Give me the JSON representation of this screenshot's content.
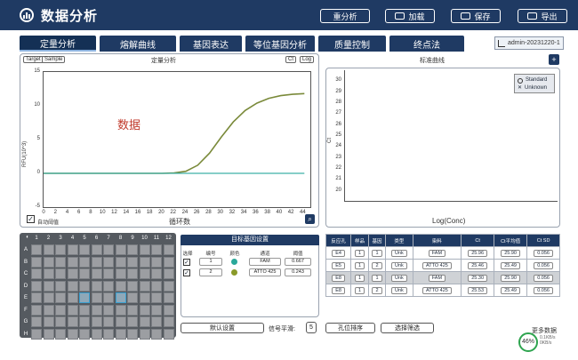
{
  "header": {
    "title": "数据分析",
    "buttons": [
      {
        "label": "重分析",
        "icon": "none"
      },
      {
        "label": "加载",
        "icon": "folder-icon"
      },
      {
        "label": "保存",
        "icon": "save-icon"
      },
      {
        "label": "导出",
        "icon": "export-icon"
      }
    ]
  },
  "tabs": [
    {
      "label": "定量分析",
      "active": true
    },
    {
      "label": "熔解曲线",
      "active": false
    },
    {
      "label": "基因表达",
      "active": false
    },
    {
      "label": "等位基因分析",
      "active": false
    },
    {
      "label": "质量控制",
      "active": false
    },
    {
      "label": "终点法",
      "active": false
    }
  ],
  "user_badge": "admin-20231220-1",
  "amp_chart": {
    "toggle_target": "Target",
    "toggle_sample": "Sample",
    "title": "定量分析",
    "scale_ct": "Ct",
    "scale_log": "Log",
    "ylabel": "RFU(10^3)",
    "xlabel": "循环数",
    "overlay_text": "数据",
    "auto_threshold": "自动阈值"
  },
  "chart_data": [
    {
      "type": "line",
      "title": "定量分析",
      "xlabel": "循环数",
      "ylabel": "RFU(10^3)",
      "xlim": [
        0,
        45
      ],
      "ylim": [
        -5,
        15
      ],
      "xticks": [
        0,
        2,
        4,
        6,
        8,
        10,
        12,
        14,
        16,
        18,
        20,
        22,
        24,
        26,
        28,
        30,
        32,
        34,
        36,
        38,
        40,
        42,
        44
      ],
      "yticks": [
        15,
        10,
        5,
        0,
        -5
      ],
      "series": [
        {
          "color": "#7a8a3a",
          "x": [
            0,
            10,
            20,
            22,
            24,
            26,
            28,
            30,
            32,
            34,
            36,
            38,
            40,
            42,
            44
          ],
          "y": [
            0,
            0,
            0,
            0.05,
            0.3,
            1.2,
            3.0,
            5.4,
            7.6,
            9.3,
            10.4,
            11.1,
            11.5,
            11.7,
            11.8
          ]
        },
        {
          "color": "#3fb0a8",
          "x": [
            0,
            10,
            20,
            30,
            40,
            44
          ],
          "y": [
            0,
            0,
            0,
            0,
            0,
            0
          ]
        }
      ]
    },
    {
      "type": "scatter",
      "title": "标准曲线",
      "xlabel": "Log(Conc)",
      "ylabel": "Ct",
      "ylim": [
        19,
        31
      ],
      "yticks": [
        30,
        29,
        28,
        27,
        26,
        25,
        24,
        23,
        22,
        21,
        20
      ],
      "legend": [
        "Standard",
        "Unknown"
      ],
      "legend_position": "top-right",
      "series": []
    }
  ],
  "std_chart": {
    "title": "标准曲线",
    "ylabel": "Ct",
    "xlabel": "Log(Conc)",
    "legend_standard": "Standard",
    "legend_unknown": "Unknown"
  },
  "plate": {
    "cols": [
      "1",
      "2",
      "3",
      "4",
      "5",
      "6",
      "7",
      "8",
      "9",
      "10",
      "11",
      "12"
    ],
    "rows": [
      "A",
      "B",
      "C",
      "D",
      "E",
      "F",
      "G",
      "H"
    ],
    "selected": [
      [
        "E",
        "5"
      ],
      [
        "E",
        "8"
      ]
    ]
  },
  "target_settings": {
    "title": "目标基因设置",
    "headers": [
      "选择",
      "编号",
      "颜色",
      "通道",
      "阈值"
    ],
    "rows": [
      {
        "id": "1",
        "color": "#2aa89a",
        "channel": "FAM",
        "threshold": "0.667"
      },
      {
        "id": "2",
        "color": "#8a9a2a",
        "channel": "ATTO 425",
        "threshold": "0.243"
      }
    ]
  },
  "results": {
    "headers": [
      "反应孔",
      "样品",
      "基因",
      "类型",
      "染料",
      "Ct",
      "Ct平均值",
      "Ct SD"
    ],
    "rows": [
      {
        "well": "E4",
        "sample": "1",
        "gene": "1",
        "type": "Unk",
        "dye": "FAM",
        "ct": "25.96",
        "ct_mean": "25.90",
        "ct_sd": "0.056"
      },
      {
        "well": "E5",
        "sample": "1",
        "gene": "2",
        "type": "Unk",
        "dye": "ATTO 425",
        "ct": "25.46",
        "ct_mean": "25.49",
        "ct_sd": "0.056"
      },
      {
        "well": "E8",
        "sample": "1",
        "gene": "1",
        "type": "Unk",
        "dye": "FAM",
        "ct": "25.30",
        "ct_mean": "25.90",
        "ct_sd": "0.056"
      },
      {
        "well": "E8",
        "sample": "1",
        "gene": "2",
        "type": "Unk",
        "dye": "ATTO 425",
        "ct": "25.53",
        "ct_mean": "25.49",
        "ct_sd": "0.056"
      }
    ]
  },
  "bottom": {
    "default_settings": "默认设置",
    "signal_smooth_label": "信号平滑:",
    "signal_smooth_value": "5",
    "sort_by_well": "孔位排序",
    "select_filter": "选择筛选",
    "more_data": "更多数据",
    "gauge_value": "46%",
    "net_up": "0.1KB/s",
    "net_down": "0KB/s"
  }
}
